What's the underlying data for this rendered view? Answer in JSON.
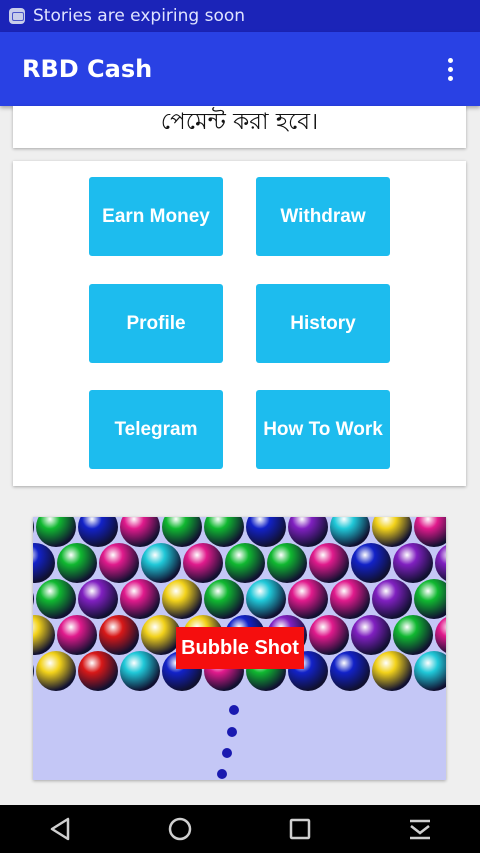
{
  "status_bar": {
    "notification_text": "Stories are expiring soon",
    "icon": "notification-app-icon"
  },
  "app_bar": {
    "title": "RBD Cash",
    "overflow_icon": "more-vert-icon"
  },
  "notice": {
    "text": "পেমেন্ট করা হবে।"
  },
  "menu": {
    "buttons": [
      {
        "label": "Earn Money"
      },
      {
        "label": "Withdraw"
      },
      {
        "label": "Profile"
      },
      {
        "label": "History"
      },
      {
        "label": "Telegram"
      },
      {
        "label": "How To Work"
      }
    ]
  },
  "ad": {
    "label": "Bubble Shot"
  },
  "nav_bar": {
    "icons": [
      "back-icon",
      "home-icon",
      "recents-icon",
      "notification-shade-icon"
    ]
  },
  "colors": {
    "status_bar": "#1b24b8",
    "app_bar": "#2941e4",
    "button": "#1dbcee",
    "ad_label": "#f50e0e"
  }
}
